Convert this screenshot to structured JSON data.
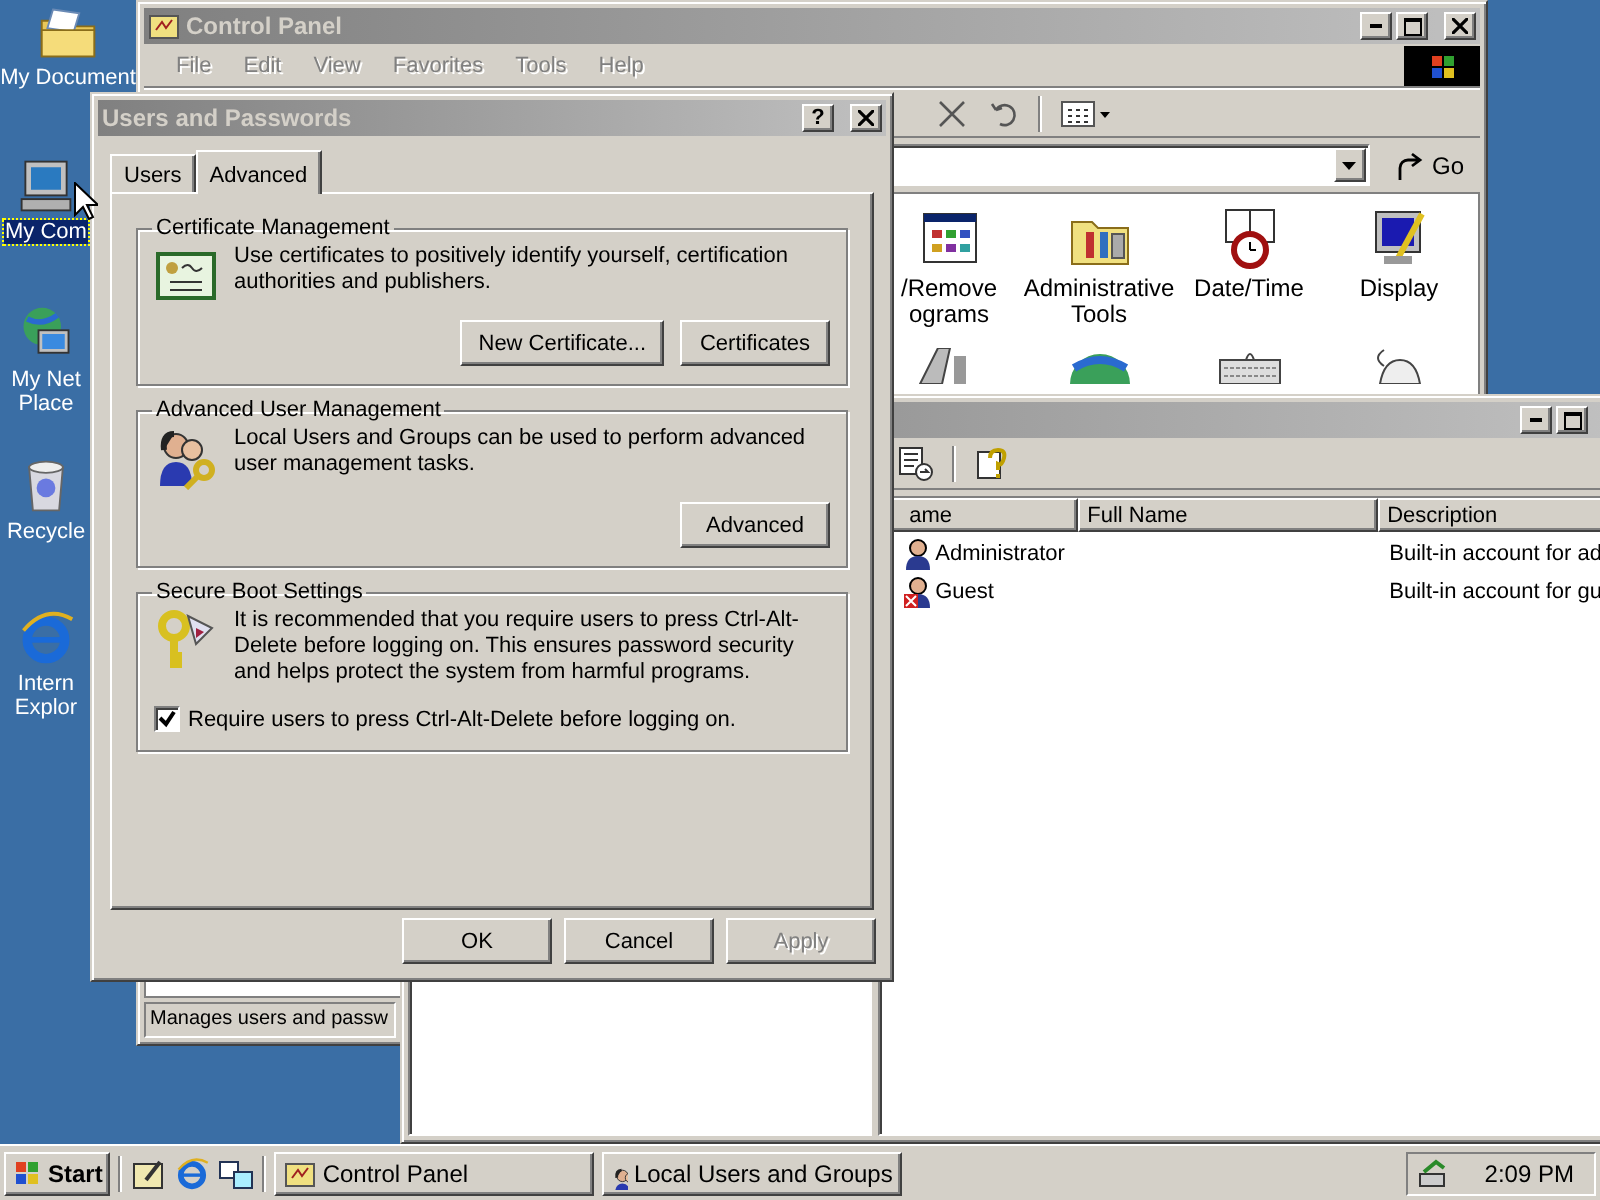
{
  "desktop": {
    "icons": [
      {
        "kind": "folder",
        "lines": [
          "My Document"
        ],
        "selected": false
      },
      {
        "kind": "computer",
        "lines": [
          "My Com"
        ],
        "selected": true
      },
      {
        "kind": "network",
        "lines": [
          "My Net",
          "Place"
        ],
        "selected": false
      },
      {
        "kind": "recycle",
        "lines": [
          "Recycle"
        ],
        "selected": false
      },
      {
        "kind": "browser",
        "lines": [
          "Intern",
          "Explor"
        ],
        "selected": false
      }
    ]
  },
  "control_panel": {
    "title": "Control Panel",
    "menu": [
      "File",
      "Edit",
      "View",
      "Favorites",
      "Tools",
      "Help"
    ],
    "go": "Go",
    "items": [
      {
        "kind": "programs",
        "lines": [
          "/Remove",
          "ograms"
        ]
      },
      {
        "kind": "tools",
        "lines": [
          "Administrative",
          "Tools"
        ]
      },
      {
        "kind": "clock",
        "lines": [
          "Date/Time"
        ]
      },
      {
        "kind": "display",
        "lines": [
          "Display"
        ]
      },
      {
        "kind": "gamepad"
      },
      {
        "kind": "globe"
      },
      {
        "kind": "keyboard"
      },
      {
        "kind": "mouse"
      }
    ],
    "status": "Manages users and passw"
  },
  "local_users": {
    "columns": [
      "ame",
      "Full Name",
      "Description"
    ],
    "rows": [
      {
        "kind": "admin",
        "name": "Administrator",
        "description": "Built-in account for ad"
      },
      {
        "kind": "guest",
        "name": "Guest",
        "description": "Built-in account for gu"
      }
    ]
  },
  "dialog": {
    "title": "Users and Passwords",
    "help": "?",
    "tabs": [
      {
        "label": "Users",
        "selected": false
      },
      {
        "label": "Advanced",
        "selected": true
      }
    ],
    "groups": [
      {
        "kind": "certificate",
        "title": "Certificate Management",
        "text": "Use certificates to positively identify yourself, certification authorities and publishers.",
        "buttons": [
          "New Certificate...",
          "Certificates"
        ]
      },
      {
        "kind": "users",
        "title": "Advanced User Management",
        "text": "Local Users and Groups can be used to perform advanced user management tasks.",
        "buttons": [
          "Advanced"
        ]
      },
      {
        "kind": "key",
        "title": "Secure Boot Settings",
        "text": "It is recommended that you require users to press Ctrl-Alt-Delete before logging on. This ensures password security and helps protect the system from harmful programs.",
        "checkbox": {
          "label": "Require users to press Ctrl-Alt-Delete before logging on.",
          "checked": true
        }
      }
    ],
    "buttons": [
      {
        "label": "OK",
        "disabled": false
      },
      {
        "label": "Cancel",
        "disabled": false
      },
      {
        "label": "Apply",
        "disabled": true
      }
    ]
  },
  "taskbar": {
    "start": "Start",
    "tasks": [
      {
        "kind": "panel",
        "label": "Control Panel",
        "selected": false
      },
      {
        "kind": "users",
        "label": "Local Users and Groups",
        "selected": false
      }
    ],
    "clock": "2:09 PM"
  }
}
